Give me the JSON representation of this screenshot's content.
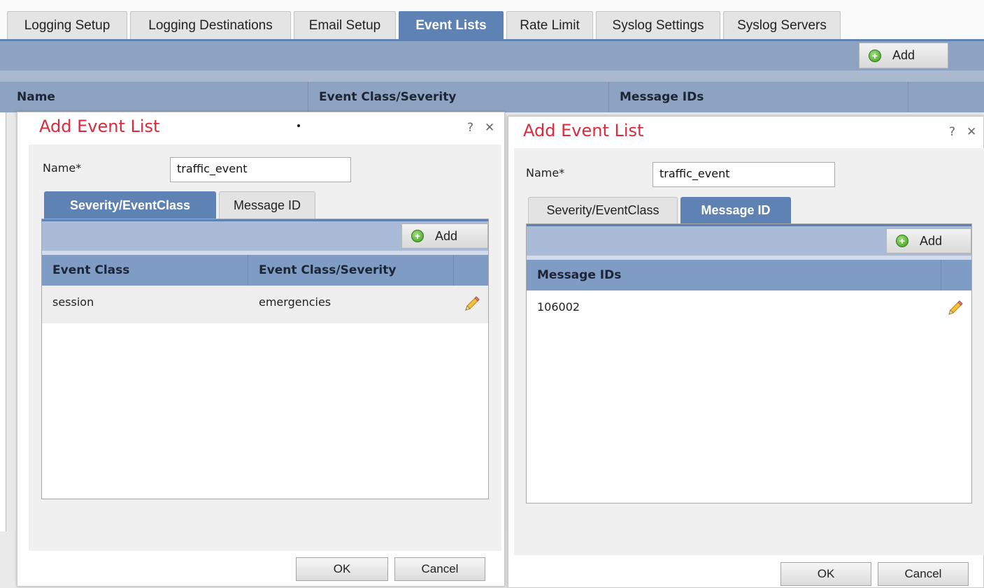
{
  "top_tabs": [
    {
      "label": "Logging Setup",
      "active": false
    },
    {
      "label": "Logging Destinations",
      "active": false
    },
    {
      "label": "Email Setup",
      "active": false
    },
    {
      "label": "Event Lists",
      "active": true
    },
    {
      "label": "Rate Limit",
      "active": false
    },
    {
      "label": "Syslog Settings",
      "active": false
    },
    {
      "label": "Syslog Servers",
      "active": false
    }
  ],
  "toolbar": {
    "add_label": "Add",
    "add_icon": "plus-circle-icon"
  },
  "table_headers": [
    "Name",
    "Event Class/Severity",
    "Message IDs"
  ],
  "dialog_left": {
    "title": "Add Event List",
    "help": "?",
    "close": "✕",
    "name_label": "Name*",
    "name_value": "traffic_event",
    "tabs": [
      "Severity/EventClass",
      "Message ID"
    ],
    "active_tab": "Severity/EventClass",
    "add_label": "Add",
    "columns": [
      "Event Class",
      "Event Class/Severity"
    ],
    "rows": [
      {
        "event_class": "session",
        "severity": "emergencies"
      }
    ],
    "ok": "OK",
    "cancel": "Cancel"
  },
  "dialog_right": {
    "title": "Add Event List",
    "help": "?",
    "close": "✕",
    "name_label": "Name*",
    "name_value": "traffic_event",
    "tabs": [
      "Severity/EventClass",
      "Message ID"
    ],
    "active_tab": "Message ID",
    "add_label": "Add",
    "columns": [
      "Message IDs"
    ],
    "rows": [
      {
        "message_id": "106002"
      }
    ],
    "ok": "OK",
    "cancel": "Cancel"
  },
  "colors": {
    "accent": "#5f82b4",
    "title_red": "#e0283c",
    "header_blue": "#7f9cc4"
  }
}
